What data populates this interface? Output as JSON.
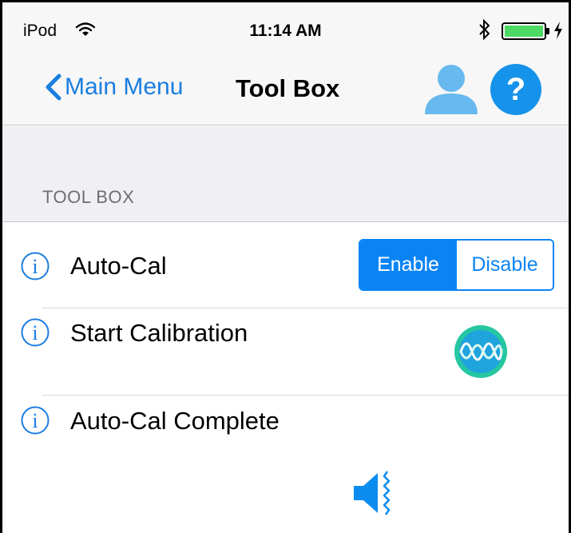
{
  "status_bar": {
    "carrier": "iPod",
    "time": "11:14 AM",
    "icons": [
      "wifi-icon",
      "bluetooth-icon",
      "battery-icon",
      "charging-bolt-icon"
    ]
  },
  "nav": {
    "back_label": "Main Menu",
    "title": "Tool Box",
    "icons": [
      "chevron-left-icon",
      "user-icon",
      "help-icon"
    ]
  },
  "section": {
    "header": "TOOL BOX"
  },
  "rows": [
    {
      "label": "Auto-Cal",
      "control": {
        "type": "segmented",
        "options": [
          "Enable",
          "Disable"
        ],
        "selected": "Enable"
      }
    },
    {
      "label": "Start Calibration",
      "control": {
        "type": "icon-button",
        "icon": "calibrate-wave-icon"
      }
    },
    {
      "label": "Auto-Cal Complete",
      "control": {
        "type": "icon-button",
        "icon": "speaker-icon"
      }
    }
  ],
  "colors": {
    "accent": "#0a84f5",
    "help_circle": "#1592ea",
    "user_icon": "#67b9ef",
    "calibrate_ring": "#25c7a0",
    "calibrate_fill": "#1fa4de",
    "battery_fill": "#4cd964"
  }
}
